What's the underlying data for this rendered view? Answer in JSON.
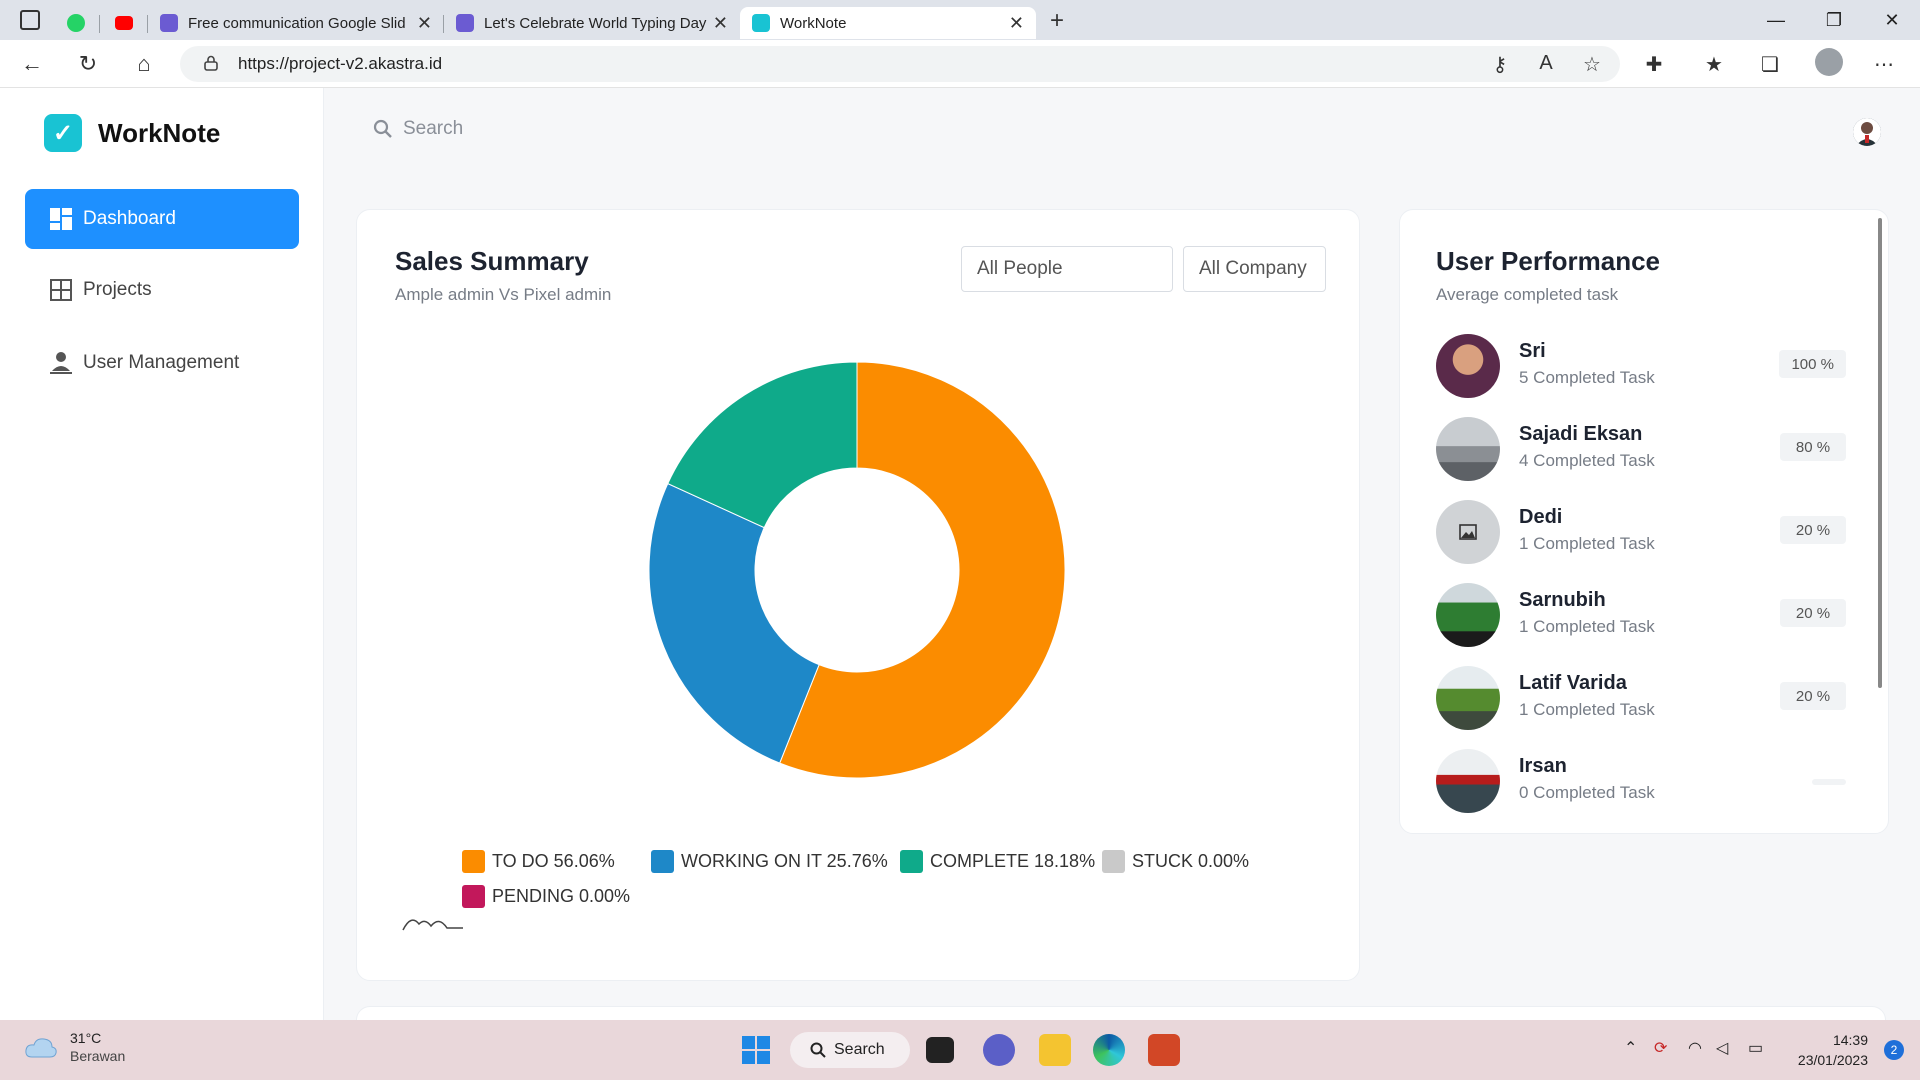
{
  "browser": {
    "tabs": [
      {
        "label": "Free communication Google Slid"
      },
      {
        "label": "Let's Celebrate World Typing Day"
      },
      {
        "label": "WorkNote"
      }
    ],
    "url": "https://project-v2.akastra.id"
  },
  "sidebar": {
    "brand": "WorkNote",
    "items": [
      {
        "label": "Dashboard"
      },
      {
        "label": "Projects"
      },
      {
        "label": "User Management"
      }
    ]
  },
  "header": {
    "search_placeholder": "Search"
  },
  "sales_summary": {
    "title": "Sales Summary",
    "subtitle": "Ample admin Vs Pixel admin",
    "filter_people": "All People",
    "filter_company": "All Company",
    "legend": [
      {
        "label": "TO DO 56.06%",
        "color": "#fb8c00"
      },
      {
        "label": "WORKING ON IT 25.76%",
        "color": "#1e88c8"
      },
      {
        "label": "COMPLETE 18.18%",
        "color": "#0faa8a"
      },
      {
        "label": "STUCK 0.00%",
        "color": "#c9c9c9"
      },
      {
        "label": "PENDING 0.00%",
        "color": "#c2185b"
      }
    ]
  },
  "chart_data": {
    "type": "pie",
    "donut": true,
    "categories": [
      "TO DO",
      "WORKING ON IT",
      "COMPLETE",
      "STUCK",
      "PENDING"
    ],
    "values": [
      56.06,
      25.76,
      18.18,
      0.0,
      0.0
    ],
    "colors": [
      "#fb8c00",
      "#1e88c8",
      "#0faa8a",
      "#c9c9c9",
      "#c2185b"
    ],
    "legend": "bottom"
  },
  "user_performance": {
    "title": "User Performance",
    "subtitle": "Average completed task",
    "users": [
      {
        "name": "Sri",
        "task": "5 Completed Task",
        "percent": "100 %"
      },
      {
        "name": "Sajadi Eksan",
        "task": "4 Completed Task",
        "percent": "80 %"
      },
      {
        "name": "Dedi",
        "task": "1 Completed Task",
        "percent": "20 %"
      },
      {
        "name": "Sarnubih",
        "task": "1 Completed Task",
        "percent": "20 %"
      },
      {
        "name": "Latif Varida",
        "task": "1 Completed Task",
        "percent": "20 %"
      },
      {
        "name": "Irsan",
        "task": "0 Completed Task",
        "percent": ""
      }
    ]
  },
  "taskbar": {
    "temperature": "31°C",
    "weather": "Berawan",
    "search": "Search",
    "time": "14:39",
    "date": "23/01/2023",
    "notifications": "2"
  }
}
